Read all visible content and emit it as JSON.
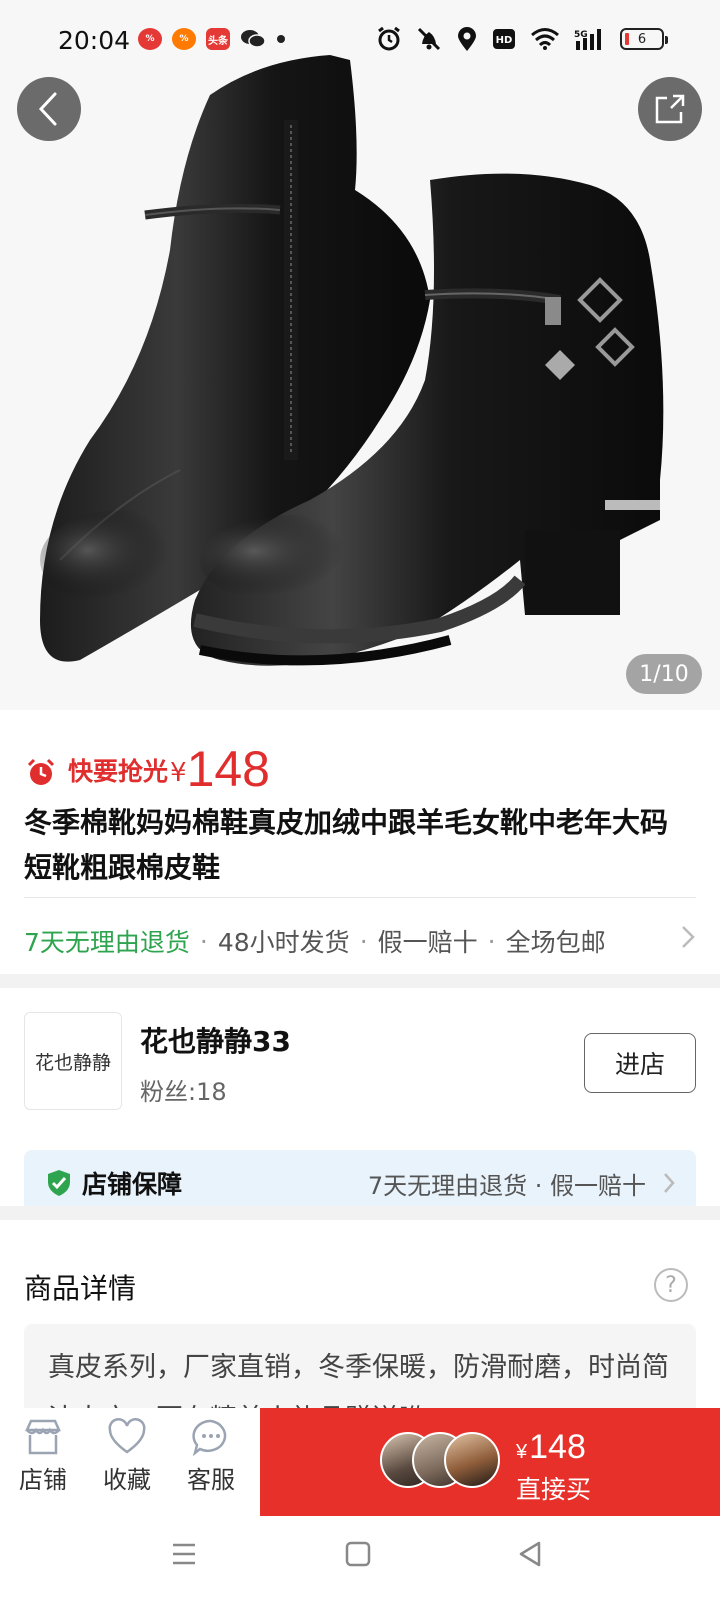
{
  "status_bar": {
    "time": "20:04",
    "apps": [
      "app-shopping",
      "app-taobao",
      "头条",
      "wechat"
    ],
    "battery": "6",
    "network": "5G"
  },
  "hero": {
    "counter": "1/10"
  },
  "product": {
    "deal_label": "快要抢光",
    "currency": "¥",
    "price": "148",
    "title": "冬季棉靴妈妈棉鞋真皮加绒中跟羊毛女靴中老年大码短靴粗跟棉皮鞋",
    "services": [
      "7天无理由退货",
      "48小时发货",
      "假一赔十",
      "全场包邮"
    ]
  },
  "shop": {
    "logo_text": "花也静静",
    "name": "花也静静33",
    "fans": "粉丝:18",
    "enter_label": "进店",
    "guarantee_title": "店铺保障",
    "guarantee_items": "7天无理由退货 · 假一赔十"
  },
  "detail": {
    "title": "商品详情",
    "help": "?",
    "text": "真皮系列，厂家直销，冬季保暖，防滑耐磨，时尚简洁大方，更有精美小礼品赠送哟"
  },
  "bottom_bar": {
    "store_label": "店铺",
    "favorite_label": "收藏",
    "service_label": "客服",
    "buy_currency": "¥",
    "buy_price": "148",
    "buy_label": "直接买"
  },
  "colors": {
    "accent_red": "#e8302a",
    "price_red": "#e02e2e",
    "service_green": "#2ea44f",
    "guarantee_bg": "#e9f3fb"
  }
}
